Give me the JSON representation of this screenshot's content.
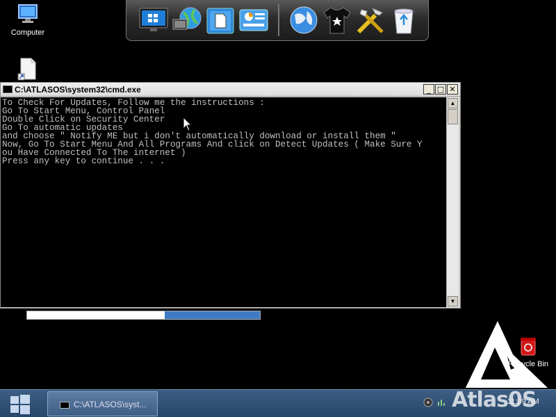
{
  "desktop": {
    "icons": [
      {
        "label": "Computer",
        "icon": "computer-icon"
      },
      {
        "label": "",
        "icon": "document-shortcut-icon"
      },
      {
        "label": "Recycle Bin",
        "icon": "recycle-bin-icon"
      }
    ]
  },
  "dock": {
    "items": [
      "monitor-icon",
      "network-icon",
      "folder-icon",
      "control-panel-icon",
      "globe-icon",
      "tshirt-icon",
      "tools-icon",
      "recycle-bin-icon"
    ]
  },
  "cmd": {
    "title": "C:\\ATLASOS\\system32\\cmd.exe",
    "buttons": {
      "minimize": "_",
      "maximize": "□",
      "close": "✕"
    },
    "lines": [
      "To Check For Updates, Follow me the instructions :",
      "Go To Start Menu, Control Panel",
      "Double Click on Security Center",
      "Go To automatic updates",
      "and choose \" Notify ME but i don't automatically download or install them \"",
      "Now, Go To Start Menu And All Programs And click on Detect Updates ( Make Sure Y",
      "ou Have Connected To The internet )",
      "Press any key to continue . . ."
    ]
  },
  "progress": {
    "value": 0.41
  },
  "taskbar": {
    "task_label": "C:\\ATLASOS\\syst...",
    "brand": "Atlas0S",
    "clock": "11:09 AM"
  },
  "colors": {
    "console_bg": "#000000",
    "console_text": "#c0c0c0",
    "taskbar": "#2f4f75",
    "progress_fill": "#3e7bc4"
  }
}
